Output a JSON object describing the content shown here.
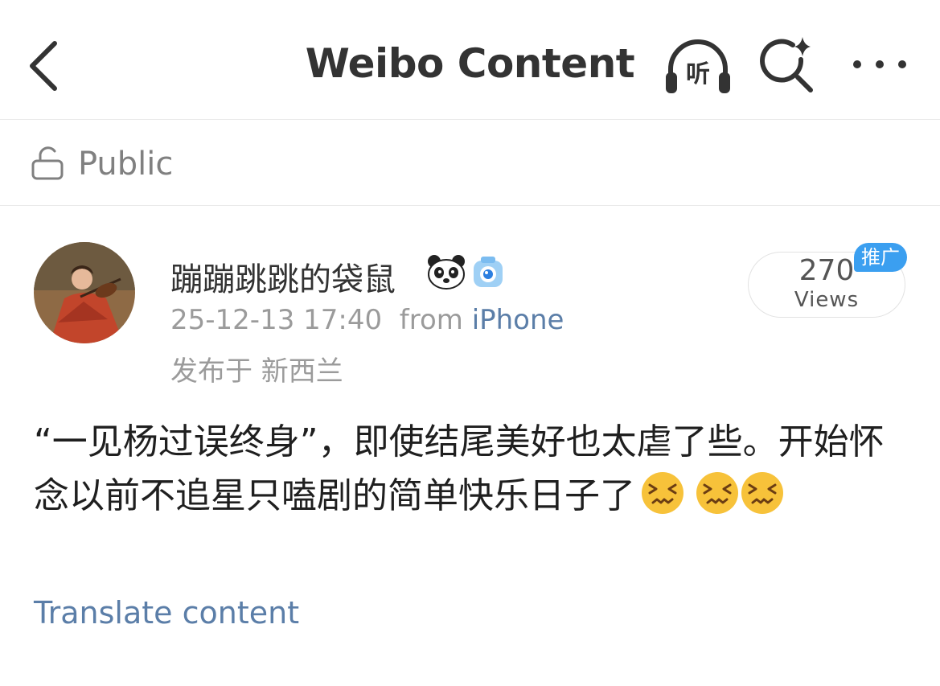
{
  "header": {
    "title": "Weibo Content",
    "icons": {
      "back": "chevron-left-icon",
      "listen": "headphones-icon",
      "search": "sparkle-search-icon",
      "more": "more-dots-icon"
    },
    "listen_glyph": "听"
  },
  "visibility": {
    "icon": "lock-open-icon",
    "label": "Public"
  },
  "post": {
    "author": "蹦蹦跳跳的袋鼠",
    "badges": [
      "panda-icon",
      "camera-icon"
    ],
    "timestamp": "25-12-13 17:40",
    "from_prefix": "from",
    "source": "iPhone",
    "location": "发布于 新西兰",
    "views": {
      "count": "270",
      "label": "Views"
    },
    "promo": "推广",
    "text": "“一见杨过误终身”，即使结尾美好也太虐了些。开始怀念以前不追星只嗑剧的简单快乐日子了",
    "emojis": [
      "confounded-emoji",
      "confounded-emoji",
      "confounded-emoji"
    ],
    "translate_label": "Translate content"
  },
  "colors": {
    "link": "#5b7ea8",
    "promo": "#3b9ff0",
    "secondary_text": "#9b9b9b"
  }
}
